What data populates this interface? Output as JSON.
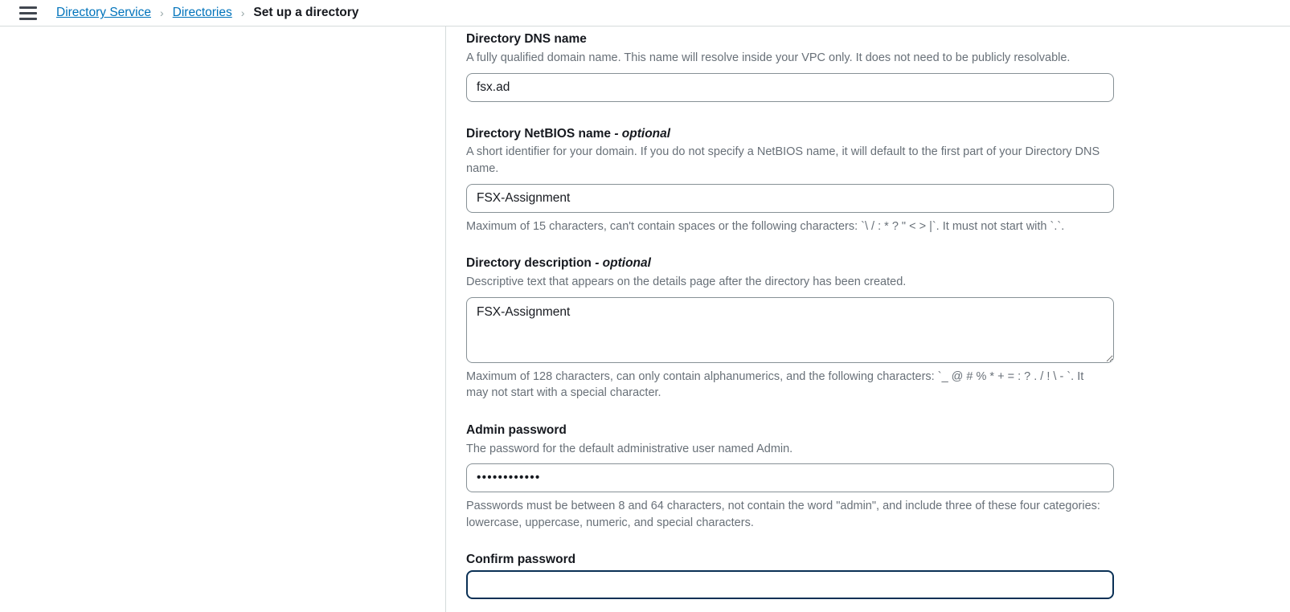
{
  "topbar": {
    "menu_icon": "hamburger-menu-icon",
    "breadcrumb": {
      "items": [
        {
          "label": "Directory Service",
          "type": "link"
        },
        {
          "label": "Directories",
          "type": "link"
        },
        {
          "label": "Set up a directory",
          "type": "current"
        }
      ],
      "separator": "›"
    }
  },
  "form": {
    "fields": {
      "dns_name": {
        "label": "Directory DNS name",
        "description": "A fully qualified domain name. This name will resolve inside your VPC only. It does not need to be publicly resolvable.",
        "value": "fsx.ad",
        "placeholder": ""
      },
      "netbios_name": {
        "label": "Directory NetBIOS name",
        "optional_suffix": "- optional",
        "description": "A short identifier for your domain. If you do not specify a NetBIOS name, it will default to the first part of your Directory DNS name.",
        "value": "FSX-Assignment",
        "placeholder": "",
        "hint": "Maximum of 15 characters, can't contain spaces or the following characters: `\\ / : * ? \" < > |`. It must not start with `.`."
      },
      "description": {
        "label": "Directory description",
        "optional_suffix": "- optional",
        "description": "Descriptive text that appears on the details page after the directory has been created.",
        "value": "FSX-Assignment",
        "placeholder": "",
        "hint": "Maximum of 128 characters, can only contain alphanumerics, and the following characters: `_ @ # % * + = : ? . / ! \\ - `. It may not start with a special character."
      },
      "admin_password": {
        "label": "Admin password",
        "description": "The password for the default administrative user named Admin.",
        "value": "••••••••••••",
        "hint": "Passwords must be between 8 and 64 characters, not contain the word \"admin\", and include three of these four categories: lowercase, uppercase, numeric, and special characters."
      },
      "confirm_password": {
        "label": "Confirm password",
        "value": "",
        "placeholder": "",
        "focused": true
      }
    }
  },
  "colors": {
    "link": "#0073bb",
    "text": "#16191f",
    "muted": "#687078",
    "border": "#879196",
    "divider": "#d5dbdb",
    "focus": "#0a3055"
  }
}
